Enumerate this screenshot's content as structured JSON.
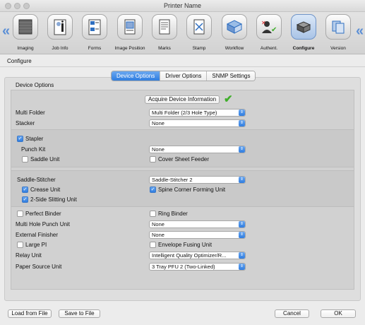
{
  "window": {
    "title": "Printer Name"
  },
  "toolbar": {
    "items": [
      {
        "label": "Imaging",
        "icon": "imaging-icon"
      },
      {
        "label": "Job Info",
        "icon": "job-info-icon"
      },
      {
        "label": "Forms",
        "icon": "forms-icon"
      },
      {
        "label": "Image Position",
        "icon": "image-position-icon"
      },
      {
        "label": "Marks",
        "icon": "marks-icon"
      },
      {
        "label": "Stamp",
        "icon": "stamp-icon"
      },
      {
        "label": "Workflow",
        "icon": "workflow-icon"
      },
      {
        "label": "Authent.",
        "icon": "authentication-icon"
      },
      {
        "label": "Configure",
        "icon": "configure-icon",
        "selected": true
      },
      {
        "label": "Version",
        "icon": "version-icon"
      }
    ],
    "prev_arrow": "«",
    "next_arrow": "«"
  },
  "section": {
    "title": "Configure"
  },
  "tabs": [
    "Device Options",
    "Driver Options",
    "SNMP Settings"
  ],
  "device_options": {
    "group_title": "Device Options",
    "acquire_button": "Acquire Device Information",
    "multi_folder": {
      "label": "Multi Folder",
      "value": "Multi Folder (2/3 Hole Type)"
    },
    "stacker": {
      "label": "Stacker",
      "value": "None"
    },
    "stapler": {
      "label": "Stapler",
      "checked": true
    },
    "punch_kit": {
      "label": "Punch Kit",
      "value": "None"
    },
    "saddle_unit": {
      "label": "Saddle Unit",
      "checked": false
    },
    "cover_sheet_feeder": {
      "label": "Cover Sheet Feeder",
      "checked": false
    },
    "saddle_stitcher": {
      "label": "Saddle-Stitcher",
      "value": "Saddle-Stitcher 2"
    },
    "crease_unit": {
      "label": "Crease Unit",
      "checked": true
    },
    "spine_corner_forming_unit": {
      "label": "Spine Corner Forming Unit",
      "checked": true
    },
    "two_side_slitting_unit": {
      "label": "2-Side Slitting Unit",
      "checked": true
    },
    "perfect_binder": {
      "label": "Perfect Binder",
      "checked": false
    },
    "ring_binder": {
      "label": "Ring Binder",
      "checked": false
    },
    "multi_hole_punch_unit": {
      "label": "Multi Hole Punch Unit",
      "value": "None"
    },
    "external_finisher": {
      "label": "External Finisher",
      "value": "None"
    },
    "large_pi": {
      "label": "Large PI",
      "checked": false
    },
    "envelope_fusing_unit": {
      "label": "Envelope Fusing Unit",
      "checked": false
    },
    "relay_unit": {
      "label": "Relay Unit",
      "value": "Intelligent Quality Optimizer/R..."
    },
    "paper_source_unit": {
      "label": "Paper Source Unit",
      "value": "3 Tray PFU 2 (Two-Linked)"
    }
  },
  "footer": {
    "load_button": "Load from File",
    "save_button": "Save to File",
    "cancel_button": "Cancel",
    "ok_button": "OK"
  },
  "colors": {
    "accent": "#2f7de0",
    "check_green": "#3fae2a"
  }
}
